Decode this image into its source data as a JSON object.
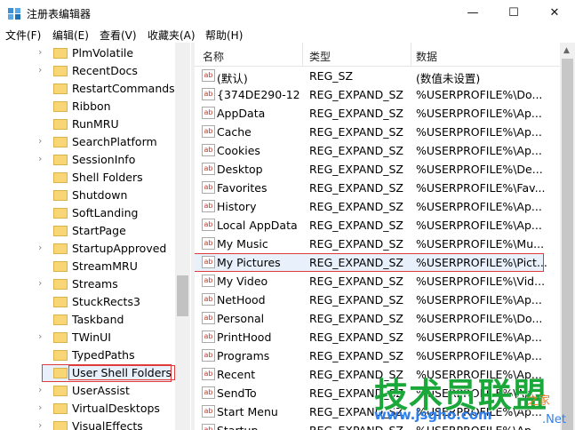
{
  "window": {
    "title": "注册表编辑器",
    "minimize": "—",
    "maximize": "☐",
    "close": "✕"
  },
  "menu": [
    "文件(F)",
    "编辑(E)",
    "查看(V)",
    "收藏夹(A)",
    "帮助(H)"
  ],
  "tree": {
    "items": [
      {
        "label": "PlmVolatile",
        "expandable": true
      },
      {
        "label": "RecentDocs",
        "expandable": true
      },
      {
        "label": "RestartCommands",
        "expandable": false
      },
      {
        "label": "Ribbon",
        "expandable": false
      },
      {
        "label": "RunMRU",
        "expandable": false
      },
      {
        "label": "SearchPlatform",
        "expandable": true
      },
      {
        "label": "SessionInfo",
        "expandable": true
      },
      {
        "label": "Shell Folders",
        "expandable": false
      },
      {
        "label": "Shutdown",
        "expandable": false
      },
      {
        "label": "SoftLanding",
        "expandable": false
      },
      {
        "label": "StartPage",
        "expandable": false
      },
      {
        "label": "StartupApproved",
        "expandable": true
      },
      {
        "label": "StreamMRU",
        "expandable": false
      },
      {
        "label": "Streams",
        "expandable": true
      },
      {
        "label": "StuckRects3",
        "expandable": false
      },
      {
        "label": "Taskband",
        "expandable": false
      },
      {
        "label": "TWinUI",
        "expandable": true
      },
      {
        "label": "TypedPaths",
        "expandable": false
      },
      {
        "label": "User Shell Folders",
        "expandable": false,
        "selected": true
      },
      {
        "label": "UserAssist",
        "expandable": true
      },
      {
        "label": "VirtualDesktops",
        "expandable": true
      },
      {
        "label": "VisualEffects",
        "expandable": true
      }
    ],
    "chevron": "›"
  },
  "list": {
    "headers": {
      "name": "名称",
      "type": "类型",
      "data": "数据"
    },
    "icon_text": "ab",
    "rows": [
      {
        "name": "(默认)",
        "type": "REG_SZ",
        "data": "(数值未设置)"
      },
      {
        "name": "{374DE290-12...",
        "type": "REG_EXPAND_SZ",
        "data": "%USERPROFILE%\\Do..."
      },
      {
        "name": "AppData",
        "type": "REG_EXPAND_SZ",
        "data": "%USERPROFILE%\\Ap..."
      },
      {
        "name": "Cache",
        "type": "REG_EXPAND_SZ",
        "data": "%USERPROFILE%\\Ap..."
      },
      {
        "name": "Cookies",
        "type": "REG_EXPAND_SZ",
        "data": "%USERPROFILE%\\Ap..."
      },
      {
        "name": "Desktop",
        "type": "REG_EXPAND_SZ",
        "data": "%USERPROFILE%\\De..."
      },
      {
        "name": "Favorites",
        "type": "REG_EXPAND_SZ",
        "data": "%USERPROFILE%\\Fav..."
      },
      {
        "name": "History",
        "type": "REG_EXPAND_SZ",
        "data": "%USERPROFILE%\\Ap..."
      },
      {
        "name": "Local AppData",
        "type": "REG_EXPAND_SZ",
        "data": "%USERPROFILE%\\Ap..."
      },
      {
        "name": "My Music",
        "type": "REG_EXPAND_SZ",
        "data": "%USERPROFILE%\\Mu..."
      },
      {
        "name": "My Pictures",
        "type": "REG_EXPAND_SZ",
        "data": "%USERPROFILE%\\Pict...",
        "selected": true
      },
      {
        "name": "My Video",
        "type": "REG_EXPAND_SZ",
        "data": "%USERPROFILE%\\Vid..."
      },
      {
        "name": "NetHood",
        "type": "REG_EXPAND_SZ",
        "data": "%USERPROFILE%\\Ap..."
      },
      {
        "name": "Personal",
        "type": "REG_EXPAND_SZ",
        "data": "%USERPROFILE%\\Do..."
      },
      {
        "name": "PrintHood",
        "type": "REG_EXPAND_SZ",
        "data": "%USERPROFILE%\\Ap..."
      },
      {
        "name": "Programs",
        "type": "REG_EXPAND_SZ",
        "data": "%USERPROFILE%\\Ap..."
      },
      {
        "name": "Recent",
        "type": "REG_EXPAND_SZ",
        "data": "%USERPROFILE%\\Ap..."
      },
      {
        "name": "SendTo",
        "type": "REG_EXPAND_SZ",
        "data": "%USERPROFILE%\\Ap..."
      },
      {
        "name": "Start Menu",
        "type": "REG_EXPAND_SZ",
        "data": "%USERPROFILE%\\Ap..."
      },
      {
        "name": "Startup",
        "type": "REG_EXPAND_SZ",
        "data": "%USERPROFILE%\\Ap..."
      }
    ]
  },
  "watermark": {
    "brand": "技术员联盟",
    "url": "www.jsgho.com",
    "home": "之家",
    "net": ".Net"
  },
  "colors": {
    "highlight_border": "#e03a3a",
    "selection_fill": "#e8f1fb",
    "watermark_green": "#1ba83a"
  },
  "icons": {
    "app": "registry-editor-icon",
    "folder": "folder-icon",
    "string_value": "reg-string-value-icon"
  }
}
